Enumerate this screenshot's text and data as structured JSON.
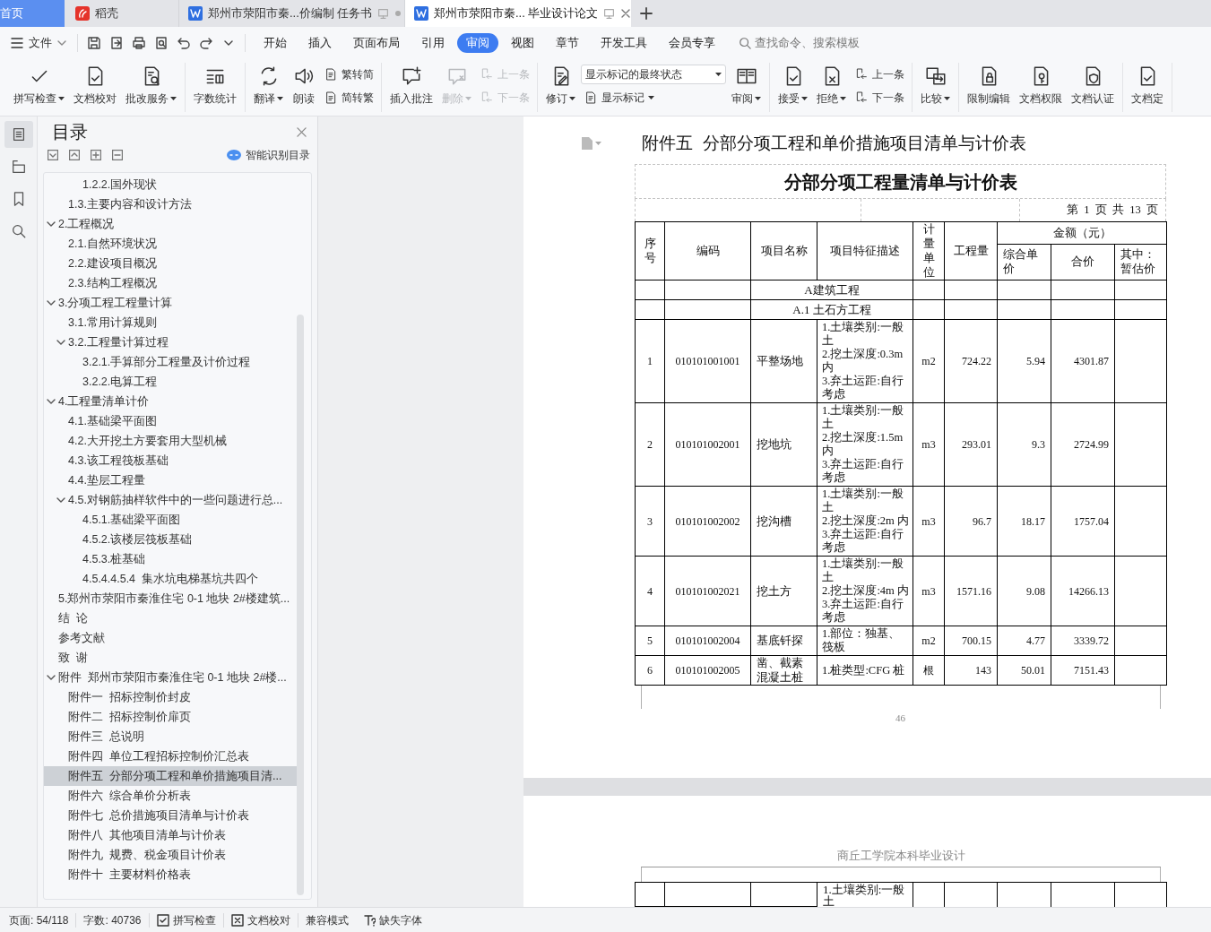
{
  "title_tabs": [
    {
      "kind": "home",
      "label": "首页",
      "selected": false
    },
    {
      "kind": "app",
      "label": "稻壳",
      "selected": false
    },
    {
      "kind": "doc",
      "label": "郑州市荥阳市秦...价编制 任务书",
      "selected": false
    },
    {
      "kind": "doc",
      "label": "郑州市荥阳市秦... 毕业设计论文",
      "selected": true
    }
  ],
  "menu": {
    "file_label": "文件",
    "tabs": [
      {
        "label": "开始",
        "selected": false
      },
      {
        "label": "插入",
        "selected": false
      },
      {
        "label": "页面布局",
        "selected": false
      },
      {
        "label": "引用",
        "selected": false
      },
      {
        "label": "审阅",
        "selected": true
      },
      {
        "label": "视图",
        "selected": false
      },
      {
        "label": "章节",
        "selected": false
      },
      {
        "label": "开发工具",
        "selected": false
      },
      {
        "label": "会员专享",
        "selected": false
      }
    ],
    "search": {
      "placeholder": "查找命令、搜索模板"
    }
  },
  "ribbon": {
    "groups": [
      [
        {
          "kind": "big",
          "label": "拼写检查",
          "dropdown": true,
          "disabled": false
        },
        {
          "kind": "big",
          "label": "文档校对",
          "dropdown": false,
          "disabled": false
        },
        {
          "kind": "big",
          "label": "批改服务",
          "dropdown": true,
          "disabled": false
        }
      ],
      [
        {
          "kind": "big",
          "label": "字数统计",
          "dropdown": false,
          "disabled": false
        }
      ],
      [
        {
          "kind": "big",
          "label": "翻译",
          "dropdown": true,
          "disabled": false
        },
        {
          "kind": "big",
          "label": "朗读",
          "dropdown": false,
          "disabled": false
        },
        {
          "kind": "pair",
          "items": [
            {
              "label": "繁转简",
              "disabled": false
            },
            {
              "label": "简转繁",
              "disabled": false
            }
          ]
        }
      ],
      [
        {
          "kind": "big",
          "label": "插入批注",
          "dropdown": false,
          "disabled": false
        },
        {
          "kind": "big",
          "label": "删除",
          "dropdown": true,
          "disabled": true
        },
        {
          "kind": "pair",
          "items": [
            {
              "label": "上一条",
              "disabled": true
            },
            {
              "label": "下一条",
              "disabled": true
            }
          ]
        }
      ],
      [
        {
          "kind": "big",
          "label": "修订",
          "dropdown": true,
          "disabled": false
        },
        {
          "kind": "select",
          "value": "显示标记的最终状态",
          "below": {
            "label": "显示标记",
            "dropdown": true
          }
        },
        {
          "kind": "big",
          "label": "审阅",
          "dropdown": true,
          "disabled": false
        }
      ],
      [
        {
          "kind": "big",
          "label": "接受",
          "dropdown": true,
          "disabled": false
        },
        {
          "kind": "big",
          "label": "拒绝",
          "dropdown": true,
          "disabled": false
        },
        {
          "kind": "pair",
          "items": [
            {
              "label": "上一条",
              "disabled": false
            },
            {
              "label": "下一条",
              "disabled": false
            }
          ]
        }
      ],
      [
        {
          "kind": "big",
          "label": "比较",
          "dropdown": true,
          "disabled": false
        }
      ],
      [
        {
          "kind": "big",
          "label": "限制编辑",
          "dropdown": false,
          "disabled": false
        },
        {
          "kind": "big",
          "label": "文档权限",
          "dropdown": false,
          "disabled": false
        },
        {
          "kind": "big",
          "label": "文档认证",
          "dropdown": false,
          "disabled": false
        }
      ],
      [
        {
          "kind": "big",
          "label": "文档定",
          "dropdown": false,
          "disabled": false
        }
      ]
    ]
  },
  "side_rail": {
    "items": [
      {
        "selected": true
      },
      {
        "selected": false
      },
      {
        "selected": false
      },
      {
        "selected": false
      }
    ]
  },
  "toc": {
    "title": "目录",
    "smart_button": "智能识别目录",
    "items": [
      {
        "children": [
          {
            "children": [
              {
                "label": "1.2.2.国外现状",
                "selected": false
              }
            ]
          },
          {
            "label": "1.3.主要内容和设计方法",
            "selected": false
          }
        ]
      },
      {
        "label": "2.工程概况",
        "selected": false,
        "expanded": true,
        "children": [
          {
            "label": "2.1.自然环境状况",
            "selected": false
          },
          {
            "label": "2.2.建设项目概况",
            "selected": false
          },
          {
            "label": "2.3.结构工程概况",
            "selected": false
          }
        ]
      },
      {
        "label": "3.分项工程工程量计算",
        "selected": false,
        "expanded": true,
        "children": [
          {
            "label": "3.1.常用计算规则",
            "selected": false
          },
          {
            "label": "3.2.工程量计算过程",
            "selected": false,
            "expanded": true,
            "children": [
              {
                "label": "3.2.1.手算部分工程量及计价过程",
                "selected": false
              },
              {
                "label": "3.2.2.电算工程",
                "selected": false
              }
            ]
          }
        ]
      },
      {
        "label": "4.工程量清单计价",
        "selected": false,
        "expanded": true,
        "children": [
          {
            "label": "4.1.基础梁平面图",
            "selected": false
          },
          {
            "label": "4.2.大开挖土方要套用大型机械",
            "selected": false
          },
          {
            "label": "4.3.该工程筏板基础",
            "selected": false
          },
          {
            "label": "4.4.垫层工程量",
            "selected": false
          },
          {
            "label": "4.5.对钢筋抽样软件中的一些问题进行总...",
            "selected": false,
            "expanded": true,
            "children": [
              {
                "label": "4.5.1.基础梁平面图",
                "selected": false
              },
              {
                "label": "4.5.2.该楼层筏板基础",
                "selected": false
              },
              {
                "label": "4.5.3.桩基础",
                "selected": false
              },
              {
                "label": "4.5.4.4.5.4  集水坑电梯基坑共四个",
                "selected": false
              }
            ]
          }
        ]
      },
      {
        "label": "5.郑州市荥阳市秦淮住宅 0-1 地块 2#楼建筑...",
        "selected": false
      },
      {
        "label": "结  论",
        "selected": false
      },
      {
        "label": "参考文献",
        "selected": false
      },
      {
        "label": "致  谢",
        "selected": false
      },
      {
        "label": "附件  郑州市荥阳市秦淮住宅 0-1 地块 2#楼...",
        "selected": false,
        "expanded": true,
        "children": [
          {
            "label": "附件一  招标控制价封皮",
            "selected": false
          },
          {
            "label": "附件二  招标控制价扉页",
            "selected": false
          },
          {
            "label": "附件三  总说明",
            "selected": false
          },
          {
            "label": "附件四  单位工程招标控制价汇总表",
            "selected": false
          },
          {
            "label": "附件五  分部分项工程和单价措施项目清...",
            "selected": true
          },
          {
            "label": "附件六  综合单价分析表",
            "selected": false
          },
          {
            "label": "附件七  总价措施项目清单与计价表",
            "selected": false
          },
          {
            "label": "附件八  其他项目清单与计价表",
            "selected": false
          },
          {
            "label": "附件九  规费、税金项目计价表",
            "selected": false
          },
          {
            "label": "附件十  主要材料价格表",
            "selected": false
          }
        ]
      }
    ]
  },
  "document": {
    "heading": "附件五  分部分项工程和单价措施项目清单与计价表",
    "table": {
      "title": "分部分项工程量清单与计价表",
      "pagination": "第  1  页  共  13  页",
      "columns": [
        "序号",
        "编码",
        "项目名称",
        "项目特征描述",
        "计量单位",
        "工程量"
      ],
      "amount_group": "金额（元）",
      "amount_columns": [
        "综合单价",
        "合价",
        "其中：暂估价"
      ],
      "rows": [
        {
          "kind": "section",
          "label": "A建筑工程"
        },
        {
          "kind": "section",
          "label": "A.1 土石方工程"
        },
        {
          "kind": "item",
          "no": "1",
          "code": "010101001001",
          "name": "平整场地",
          "description": [
            "1.土壤类别:一般土",
            "2.挖土深度:0.3m内",
            "3.弃土运距:自行考虑"
          ],
          "unit": "m2",
          "quantity": "724.22",
          "unit_price": "5.94",
          "total": "4301.87"
        },
        {
          "kind": "item",
          "no": "2",
          "code": "010101002001",
          "name": "挖地坑",
          "description": [
            "1.土壤类别:一般土",
            "2.挖土深度:1.5m内",
            "3.弃土运距:自行考虑"
          ],
          "unit": "m3",
          "quantity": "293.01",
          "unit_price": "9.3",
          "total": "2724.99"
        },
        {
          "kind": "item",
          "no": "3",
          "code": "010101002002",
          "name": "挖沟槽",
          "description": [
            "1.土壤类别:一般土",
            "2.挖土深度:2m 内",
            "3.弃土运距:自行考虑"
          ],
          "unit": "m3",
          "quantity": "96.7",
          "unit_price": "18.17",
          "total": "1757.04"
        },
        {
          "kind": "item",
          "no": "4",
          "code": "010101002021",
          "name": "挖土方",
          "description": [
            "1.土壤类别:一般土",
            "2.挖土深度:4m 内",
            "3.弃土运距:自行考虑"
          ],
          "unit": "m3",
          "quantity": "1571.16",
          "unit_price": "9.08",
          "total": "14266.13"
        },
        {
          "kind": "item",
          "no": "5",
          "code": "010101002004",
          "name": "基底钎探",
          "description": [
            "1.部位：独基、筏板"
          ],
          "unit": "m2",
          "quantity": "700.15",
          "unit_price": "4.77",
          "total": "3339.72"
        },
        {
          "kind": "item",
          "no": "6",
          "code": "010101002005",
          "name": "凿、截素混凝土桩",
          "description": [
            "1.桩类型:CFG 桩"
          ],
          "unit": "根",
          "quantity": "143",
          "unit_price": "50.01",
          "total": "7151.43"
        }
      ]
    },
    "page_number": "46",
    "next_page": {
      "header": "商丘工学院本科毕业设计",
      "description": [
        "1.土壤类别:一般土"
      ]
    }
  },
  "status_bar": [
    {
      "kind": "page",
      "label": "页面: 54/118"
    },
    {
      "kind": "words",
      "label": "字数: 40736"
    },
    {
      "kind": "spell",
      "label": "拼写检查"
    },
    {
      "kind": "proof",
      "label": "文档校对"
    },
    {
      "kind": "mode",
      "label": "兼容模式"
    },
    {
      "kind": "font",
      "label": "缺失字体"
    }
  ]
}
